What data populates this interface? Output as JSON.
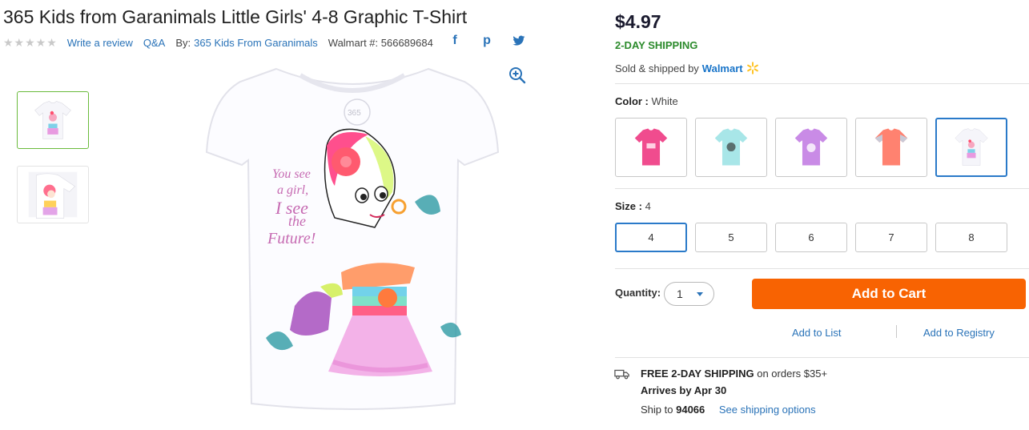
{
  "product": {
    "title": "365 Kids from Garanimals Little Girls' 4-8 Graphic T-Shirt",
    "stars": "★★★★★",
    "write_review": "Write a review",
    "qa": "Q&A",
    "by_label": "By:",
    "brand": "365 Kids From Garanimals",
    "walmart_number": "Walmart #: 566689684"
  },
  "social": {
    "facebook": "f",
    "pinterest": "p"
  },
  "buybox": {
    "price": "$4.97",
    "shipping_badge": "2-DAY SHIPPING",
    "sold_by": "Sold & shipped by",
    "seller": "Walmart",
    "color_label": "Color :",
    "color_value": "White",
    "size_label": "Size :",
    "size_value": "4",
    "sizes": [
      "4",
      "5",
      "6",
      "7",
      "8"
    ],
    "selected_size": "4",
    "quantity_label": "Quantity:",
    "quantity_value": "1",
    "add_to_cart": "Add to Cart",
    "add_to_list": "Add to List",
    "add_to_registry": "Add to Registry"
  },
  "shipping": {
    "free_title": "FREE 2-DAY SHIPPING",
    "free_rest": "on orders $35+",
    "arrives": "Arrives by Apr 30",
    "ship_to_label": "Ship to",
    "zip": "94066",
    "see_options": "See shipping options"
  },
  "colors": {
    "accent": "#2a73b8",
    "cart": "#f86302",
    "shipping_green": "#2b8a2b",
    "selected_thumb": "#6abb3c",
    "walmart_spark": "#ffc220"
  },
  "icons": {
    "zoom": "zoom-in-icon",
    "truck": "truck-icon",
    "spark": "walmart-spark-icon",
    "caret": "chevron-down-icon",
    "facebook": "facebook-icon",
    "pinterest": "pinterest-icon",
    "twitter": "twitter-icon"
  }
}
